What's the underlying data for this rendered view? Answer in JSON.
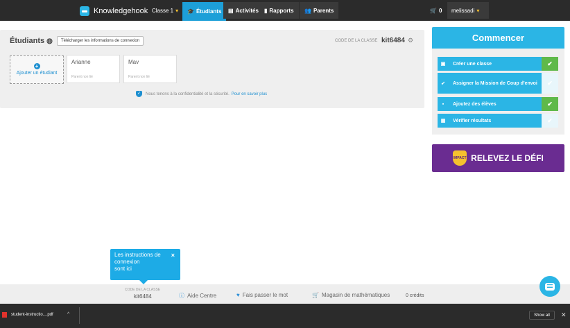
{
  "nav": {
    "brand": "Knowledgehook",
    "classe": "Classe 1",
    "etudiants": "Étudiants",
    "activites": "Activités",
    "rapports": "Rapports",
    "parents": "Parents",
    "cart_count": "0",
    "user": "melissadi"
  },
  "panel": {
    "title": "Étudiants",
    "download_btn": "Télécharger les informations de connexion",
    "code_label": "CODE DE LA CLASSE",
    "code_value": "kit6484",
    "add_student": "Ajouter un étudiant",
    "students": [
      {
        "name": "Arianne",
        "parent": "Parent non lié"
      },
      {
        "name": "Mav",
        "parent": "Parent non lié"
      }
    ],
    "privacy_text": "Nous tenons à la confidentialité et la sécurité.",
    "privacy_link": "Pour en savoir plus"
  },
  "start": {
    "title": "Commencer",
    "tasks": [
      {
        "label": "Créer une classe",
        "done": true,
        "icon": "folder-plus-icon"
      },
      {
        "label": "Assigner la Mission de Coup d'envoi",
        "done": false,
        "icon": "rocket-icon"
      },
      {
        "label": "Ajoutez des élèves",
        "done": true,
        "icon": "user-icon"
      },
      {
        "label": "Vérifier résultats",
        "done": false,
        "icon": "report-icon"
      }
    ]
  },
  "defi": {
    "badge": "IMPACT",
    "label": "RELEVEZ LE DÉFI"
  },
  "tooltip": {
    "text_line1": "Les instructions de",
    "text_line2": "connexion",
    "text_line3": "sont ici",
    "close": "×"
  },
  "footer": {
    "code_label": "CODE DE LA CLASSE",
    "code_value": "kit6484",
    "help": "Aide Centre",
    "share": "Fais passer le mot",
    "shop": "Magasin de mathématiques",
    "credits": "0 crédits"
  },
  "downloads": {
    "file_name": "student-instructio....pdf",
    "show_all": "Show all",
    "close": "✕"
  },
  "colors": {
    "accent": "#2bb5e5",
    "topbar": "#2b2b2b",
    "done": "#5fb94a",
    "defi": "#6a2c91"
  }
}
